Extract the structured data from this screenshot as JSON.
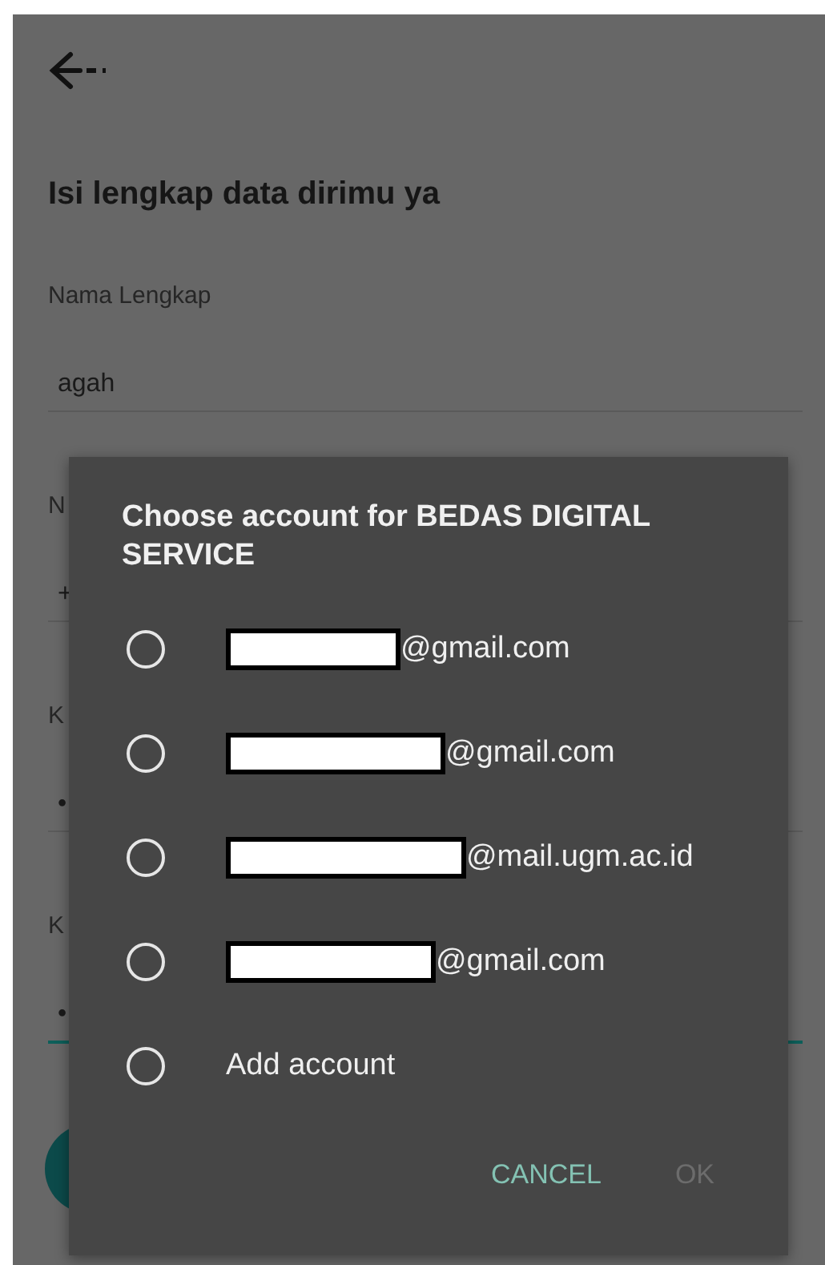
{
  "header": {
    "title": "Isi lengkap data dirimu ya"
  },
  "fields": [
    {
      "label": "Nama Lengkap",
      "value": "agah",
      "focused": false
    },
    {
      "label": "N",
      "value": "+",
      "focused": false
    },
    {
      "label": "K",
      "value": "•",
      "focused": false
    },
    {
      "label": "K",
      "value": "•",
      "focused": true
    }
  ],
  "dialog": {
    "title": "Choose account for BEDAS DIGITAL SERVICE",
    "options": [
      {
        "kind": "account",
        "text": "@gmail.com",
        "selected": false
      },
      {
        "kind": "account",
        "text": "@gmail.com",
        "selected": false
      },
      {
        "kind": "account",
        "text": "@mail.ugm.ac.id",
        "selected": false
      },
      {
        "kind": "account",
        "text": "@gmail.com",
        "selected": false
      },
      {
        "kind": "add",
        "text": "Add account",
        "selected": false
      }
    ],
    "buttons": [
      {
        "label": "CANCEL",
        "disabled": false
      },
      {
        "label": "OK",
        "disabled": true
      }
    ]
  }
}
